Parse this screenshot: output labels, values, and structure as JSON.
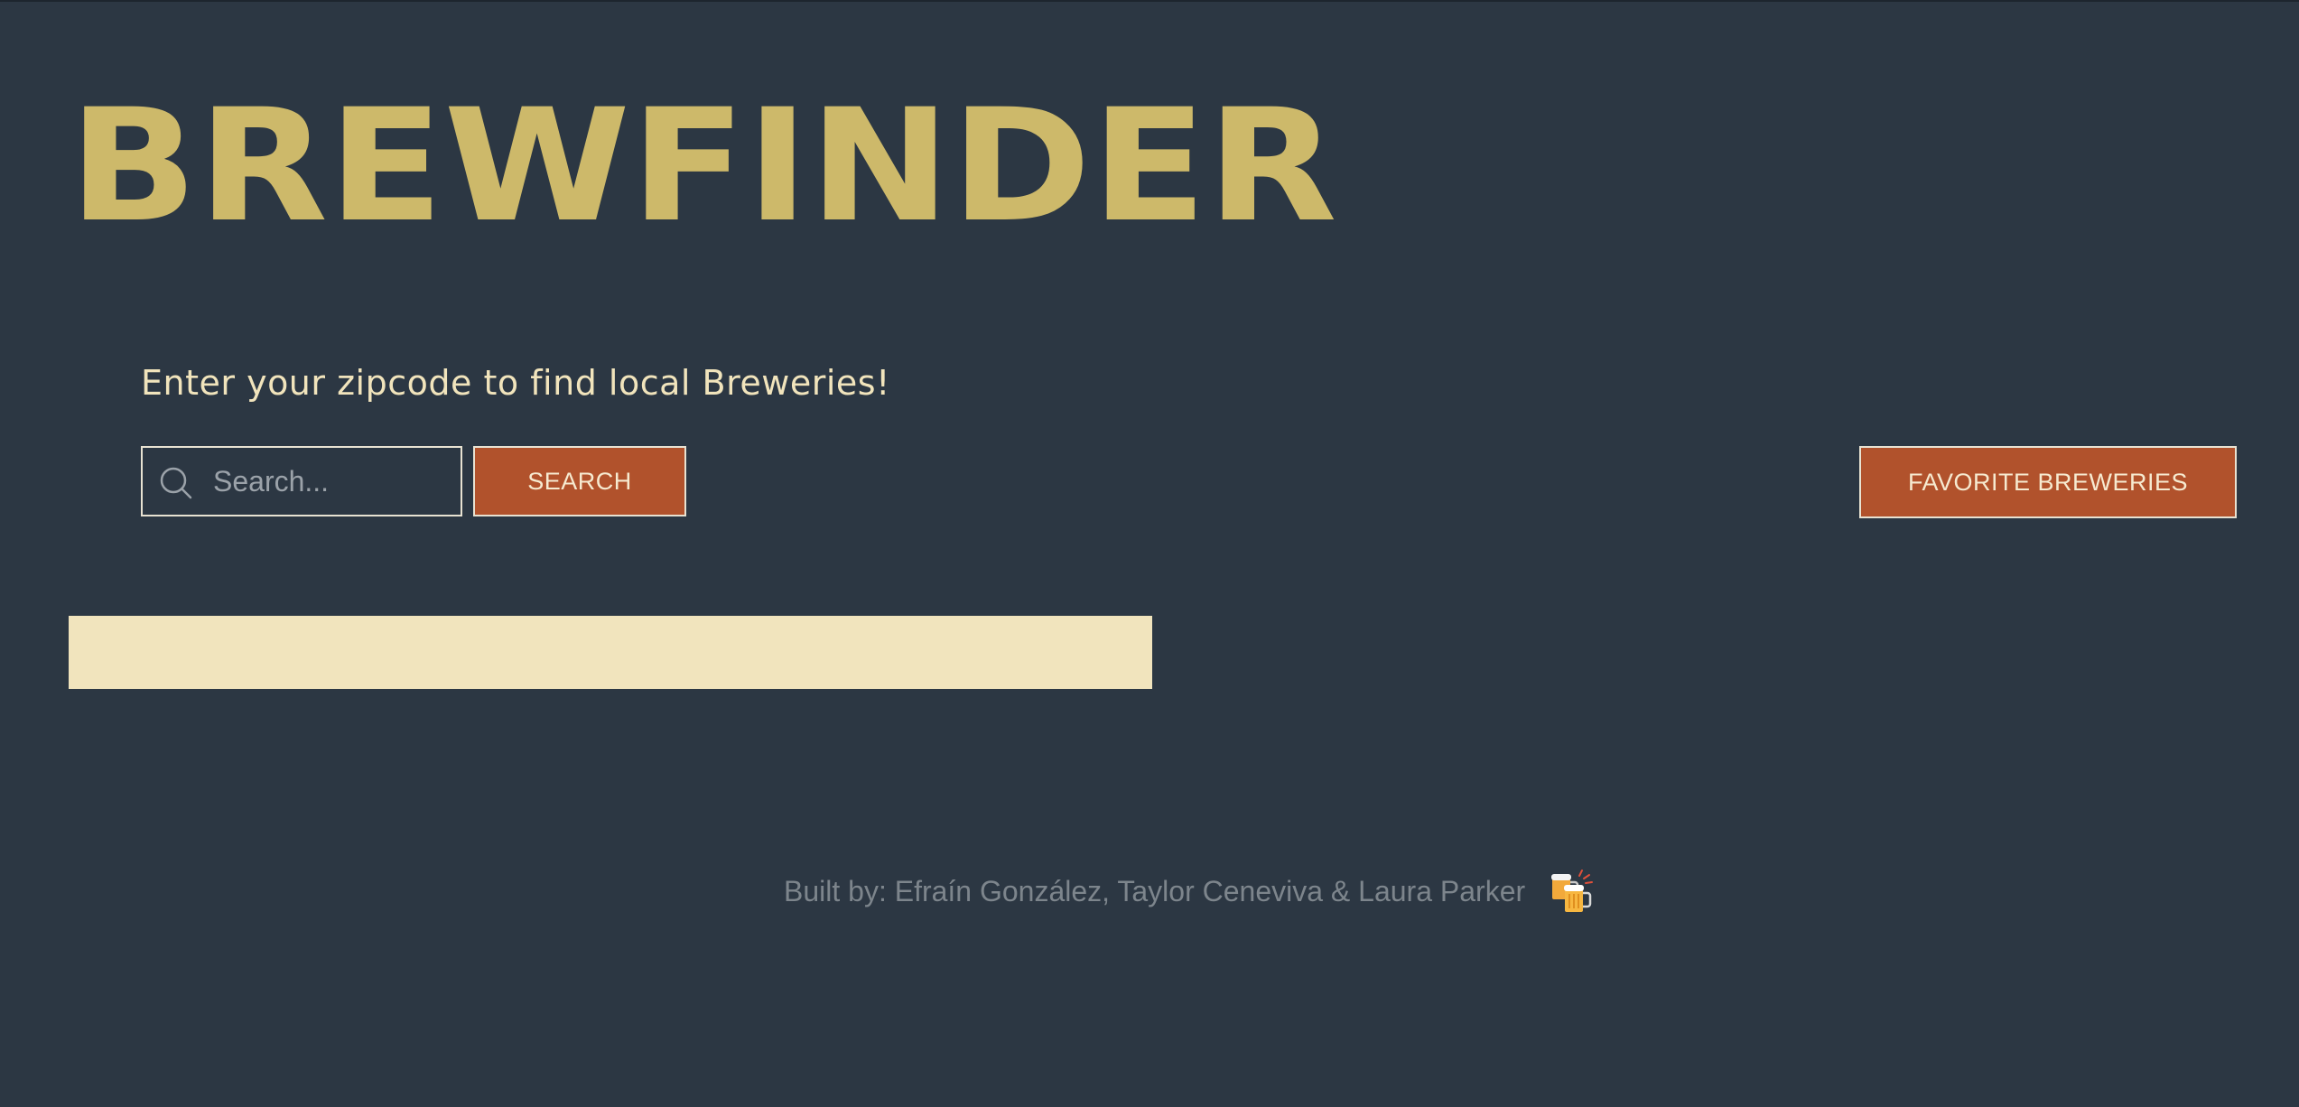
{
  "header": {
    "logo_text": "BREWFINDER"
  },
  "main": {
    "tagline": "Enter your zipcode to find local Breweries!",
    "search": {
      "placeholder": "Search...",
      "value": "",
      "icon": "search-icon"
    },
    "search_button_label": "SEARCH",
    "favorites_button_label": "FAVORITE BREWERIES"
  },
  "footer": {
    "credits": "Built by: Efraín González, Taylor Ceneviva & Laura Parker",
    "icon": "clinking-beer-mugs-icon"
  },
  "colors": {
    "background": "#2c3743",
    "logo": "#cdb96a",
    "tagline": "#f1e4bc",
    "button": "#b1522c",
    "results_bar": "#f1e4bd",
    "footer_text": "#7d858c"
  }
}
